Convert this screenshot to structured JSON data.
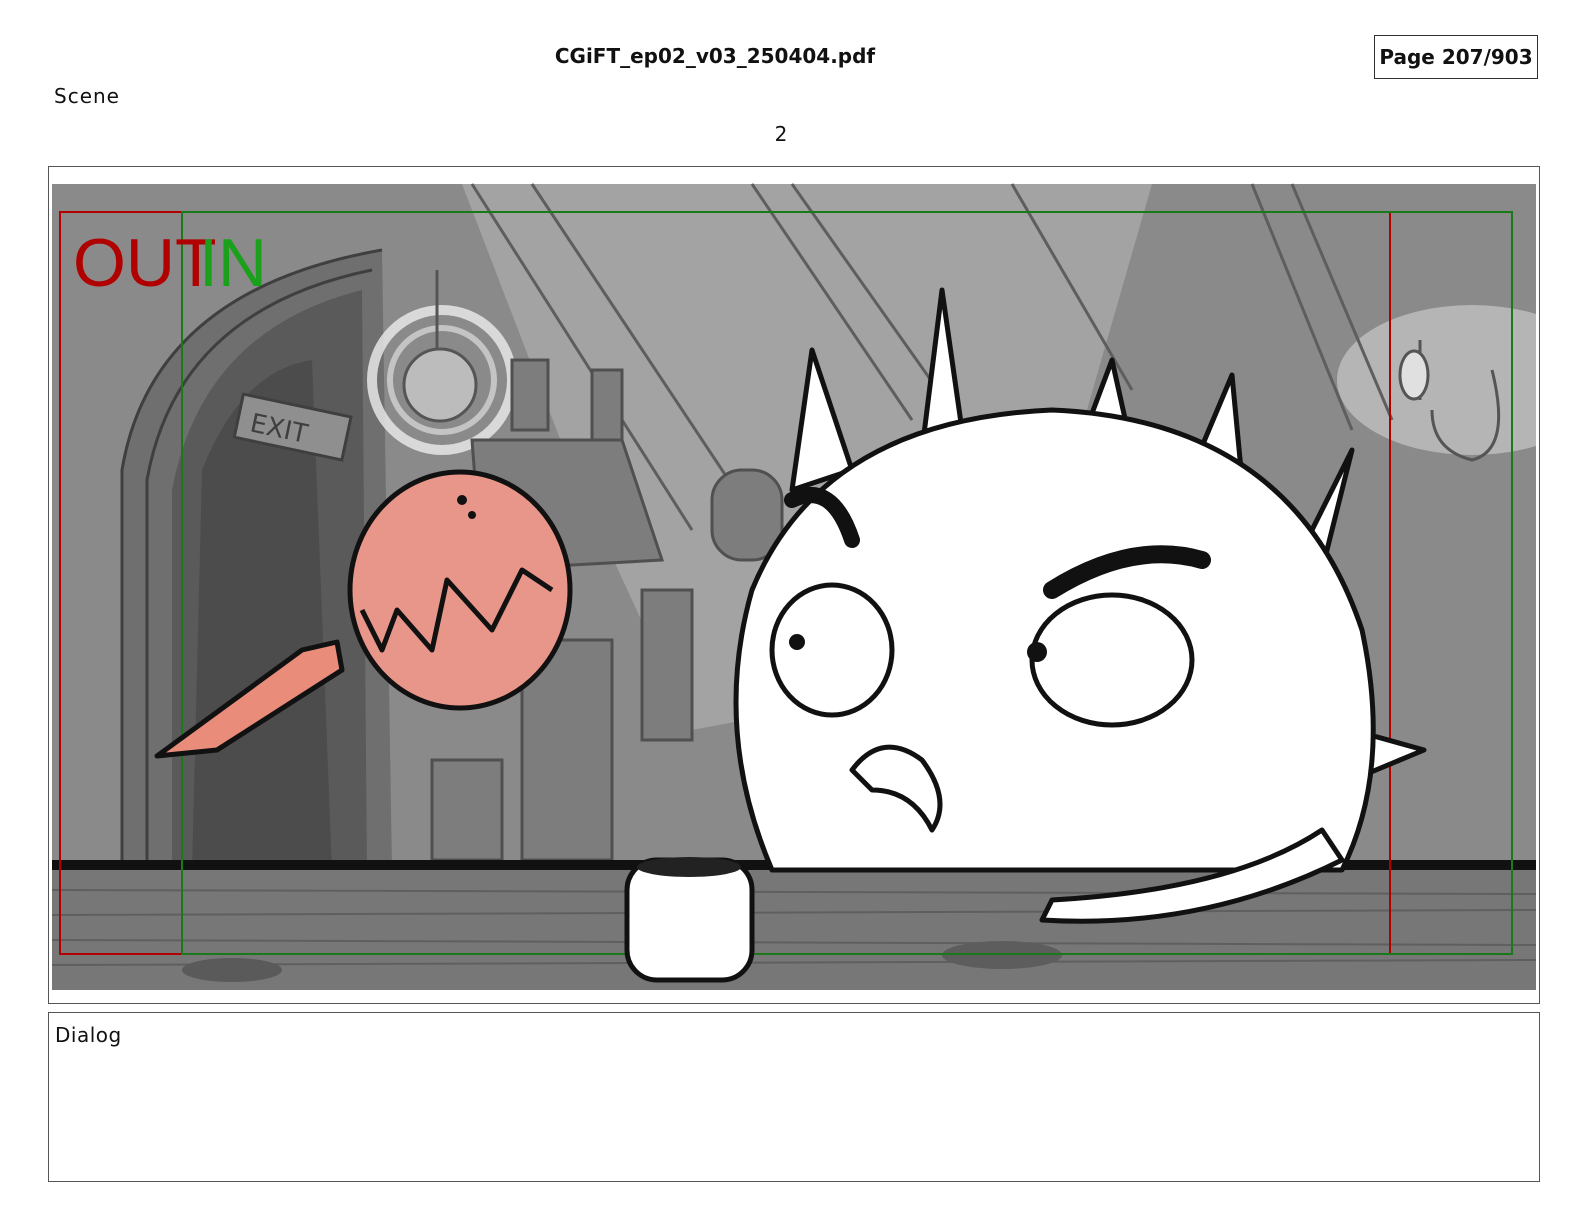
{
  "header": {
    "document_title": "CGiFT_ep02_v03_250404.pdf",
    "page_indicator": "Page 207/903"
  },
  "scene": {
    "label": "Scene",
    "number": "2"
  },
  "panel": {
    "overlay_out": "OUT",
    "overlay_in": "IN",
    "sign_text": "EXIT",
    "out_frame_color": "#b00000",
    "in_frame_color": "#1a7a1a"
  },
  "dialog": {
    "label": "Dialog",
    "text": ""
  }
}
